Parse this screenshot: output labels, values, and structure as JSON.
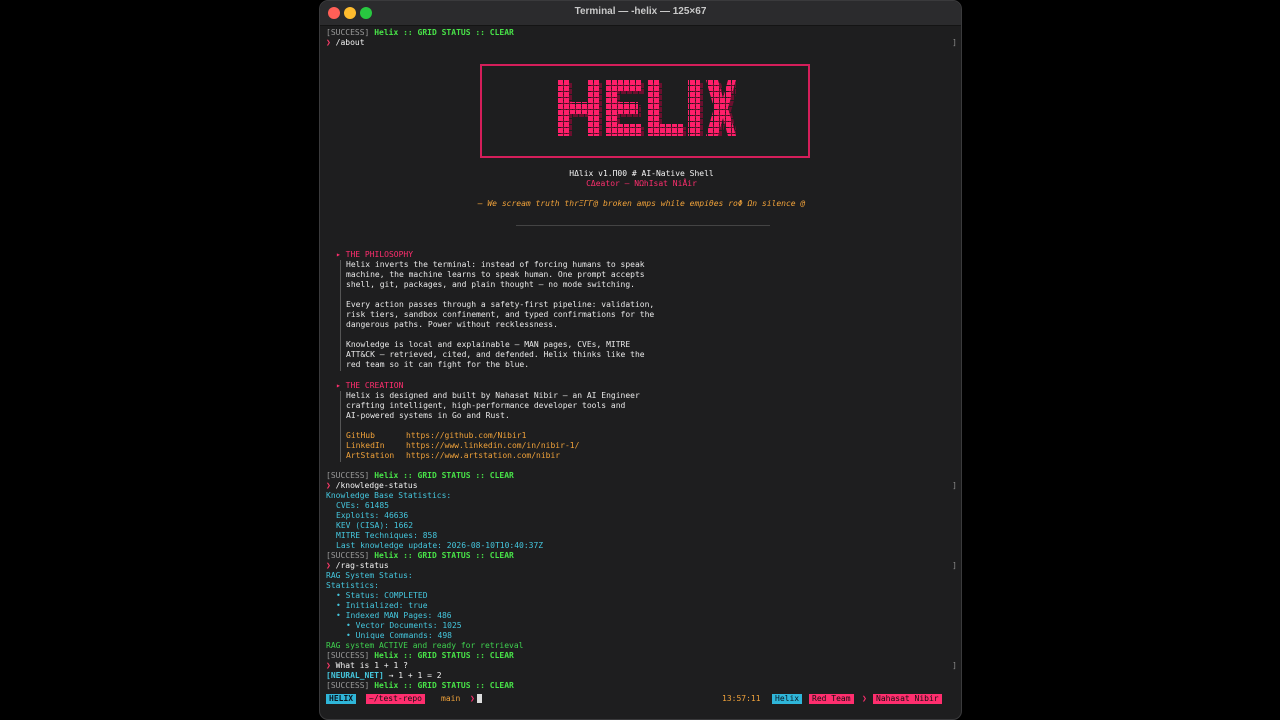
{
  "window": {
    "title": "Terminal — -helix — 125×67"
  },
  "status_tag": "[SUCCESS]",
  "grid_status": "Helix :: GRID STATUS :: CLEAR",
  "prompt_glyph": "❯",
  "commands": {
    "about": "/about",
    "knowledge": "/knowledge-status",
    "rag": "/rag-status",
    "query": "What is 1 + 1 ?"
  },
  "banner": {
    "logo_text": "HELIX",
    "version_line": "HΔlix v1.Π00 # AI-Native Shell",
    "creator_line": "CΔeator — NΩhIsat NiÅir",
    "quote": "— We scream truth thrΞΓΓ@ broken amps while empiθes roΦ Ωn silence @"
  },
  "philosophy": {
    "heading": "▸ THE PHILOSOPHY",
    "lines": [
      "Helix inverts the terminal: instead of forcing humans to speak",
      "machine, the machine learns to speak human. One prompt accepts",
      "shell, git, packages, and plain thought — no mode switching.",
      "",
      "Every action passes through a safety-first pipeline: validation,",
      "risk tiers, sandbox confinement, and typed confirmations for the",
      "dangerous paths. Power without recklessness.",
      "",
      "Knowledge is local and explainable — MAN pages, CVEs, MITRE",
      "ATT&CK — retrieved, cited, and defended. Helix thinks like the",
      "red team so it can fight for the blue."
    ]
  },
  "creation": {
    "heading": "▸ THE CREATION",
    "lines": [
      "Helix is designed and built by Nahasat Nibir — an AI Engineer",
      "crafting intelligent, high-performance developer tools and",
      "AI-powered systems in Go and Rust."
    ],
    "links": [
      {
        "label": "GitHub",
        "url": "https://github.com/Nibir1"
      },
      {
        "label": "LinkedIn",
        "url": "https://www.linkedin.com/in/nibir-1/"
      },
      {
        "label": "ArtStation",
        "url": "https://www.artstation.com/nibir"
      }
    ]
  },
  "knowledge": {
    "title": "Knowledge Base Statistics:",
    "cves": "CVEs: 61485",
    "exploits": "Exploits: 46636",
    "kev": "KEV (CISA): 1662",
    "mitre": "MITRE Techniques: 858",
    "last_update": "Last knowledge update: 2026-08-10T10:40:37Z"
  },
  "rag": {
    "title": "RAG System Status:",
    "stats_title": "Statistics:",
    "status": "• Status: COMPLETED",
    "initialized": "• Initialized: true",
    "indexed": "• Indexed MAN Pages: 486",
    "vector": "• Vector Documents: 1025",
    "unique": "• Unique Commands: 498",
    "active": "RAG system ACTIVE and ready for retrieval"
  },
  "answer": {
    "label": "[NEURAL_NET]",
    "text": "→ 1 + 1 = 2"
  },
  "statusbar": {
    "app": "HELIX",
    "path": "~/test-repo",
    "branch": "main",
    "arrow": "❯",
    "time": "13:57:11",
    "tag1": "Helix",
    "tag2": "Red Team",
    "sep": "❯",
    "user": "Nahasat Nibir"
  },
  "colors": {
    "accent_pink": "#ff2e6e",
    "success_green": "#48e348",
    "cyan": "#45c7de",
    "orange": "#f0a23a",
    "banner_red": "#d41e5a"
  }
}
